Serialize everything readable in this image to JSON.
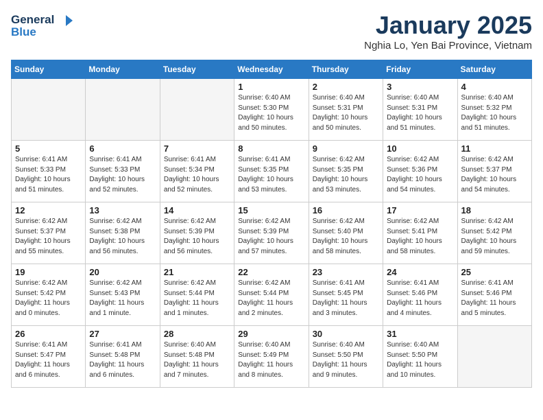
{
  "header": {
    "logo_line1": "General",
    "logo_line2": "Blue",
    "month": "January 2025",
    "location": "Nghia Lo, Yen Bai Province, Vietnam"
  },
  "days_of_week": [
    "Sunday",
    "Monday",
    "Tuesday",
    "Wednesday",
    "Thursday",
    "Friday",
    "Saturday"
  ],
  "weeks": [
    [
      {
        "day": "",
        "info": ""
      },
      {
        "day": "",
        "info": ""
      },
      {
        "day": "",
        "info": ""
      },
      {
        "day": "1",
        "info": "Sunrise: 6:40 AM\nSunset: 5:30 PM\nDaylight: 10 hours\nand 50 minutes."
      },
      {
        "day": "2",
        "info": "Sunrise: 6:40 AM\nSunset: 5:31 PM\nDaylight: 10 hours\nand 50 minutes."
      },
      {
        "day": "3",
        "info": "Sunrise: 6:40 AM\nSunset: 5:31 PM\nDaylight: 10 hours\nand 51 minutes."
      },
      {
        "day": "4",
        "info": "Sunrise: 6:40 AM\nSunset: 5:32 PM\nDaylight: 10 hours\nand 51 minutes."
      }
    ],
    [
      {
        "day": "5",
        "info": "Sunrise: 6:41 AM\nSunset: 5:33 PM\nDaylight: 10 hours\nand 51 minutes."
      },
      {
        "day": "6",
        "info": "Sunrise: 6:41 AM\nSunset: 5:33 PM\nDaylight: 10 hours\nand 52 minutes."
      },
      {
        "day": "7",
        "info": "Sunrise: 6:41 AM\nSunset: 5:34 PM\nDaylight: 10 hours\nand 52 minutes."
      },
      {
        "day": "8",
        "info": "Sunrise: 6:41 AM\nSunset: 5:35 PM\nDaylight: 10 hours\nand 53 minutes."
      },
      {
        "day": "9",
        "info": "Sunrise: 6:42 AM\nSunset: 5:35 PM\nDaylight: 10 hours\nand 53 minutes."
      },
      {
        "day": "10",
        "info": "Sunrise: 6:42 AM\nSunset: 5:36 PM\nDaylight: 10 hours\nand 54 minutes."
      },
      {
        "day": "11",
        "info": "Sunrise: 6:42 AM\nSunset: 5:37 PM\nDaylight: 10 hours\nand 54 minutes."
      }
    ],
    [
      {
        "day": "12",
        "info": "Sunrise: 6:42 AM\nSunset: 5:37 PM\nDaylight: 10 hours\nand 55 minutes."
      },
      {
        "day": "13",
        "info": "Sunrise: 6:42 AM\nSunset: 5:38 PM\nDaylight: 10 hours\nand 56 minutes."
      },
      {
        "day": "14",
        "info": "Sunrise: 6:42 AM\nSunset: 5:39 PM\nDaylight: 10 hours\nand 56 minutes."
      },
      {
        "day": "15",
        "info": "Sunrise: 6:42 AM\nSunset: 5:39 PM\nDaylight: 10 hours\nand 57 minutes."
      },
      {
        "day": "16",
        "info": "Sunrise: 6:42 AM\nSunset: 5:40 PM\nDaylight: 10 hours\nand 58 minutes."
      },
      {
        "day": "17",
        "info": "Sunrise: 6:42 AM\nSunset: 5:41 PM\nDaylight: 10 hours\nand 58 minutes."
      },
      {
        "day": "18",
        "info": "Sunrise: 6:42 AM\nSunset: 5:42 PM\nDaylight: 10 hours\nand 59 minutes."
      }
    ],
    [
      {
        "day": "19",
        "info": "Sunrise: 6:42 AM\nSunset: 5:42 PM\nDaylight: 11 hours\nand 0 minutes."
      },
      {
        "day": "20",
        "info": "Sunrise: 6:42 AM\nSunset: 5:43 PM\nDaylight: 11 hours\nand 1 minute."
      },
      {
        "day": "21",
        "info": "Sunrise: 6:42 AM\nSunset: 5:44 PM\nDaylight: 11 hours\nand 1 minutes."
      },
      {
        "day": "22",
        "info": "Sunrise: 6:42 AM\nSunset: 5:44 PM\nDaylight: 11 hours\nand 2 minutes."
      },
      {
        "day": "23",
        "info": "Sunrise: 6:41 AM\nSunset: 5:45 PM\nDaylight: 11 hours\nand 3 minutes."
      },
      {
        "day": "24",
        "info": "Sunrise: 6:41 AM\nSunset: 5:46 PM\nDaylight: 11 hours\nand 4 minutes."
      },
      {
        "day": "25",
        "info": "Sunrise: 6:41 AM\nSunset: 5:46 PM\nDaylight: 11 hours\nand 5 minutes."
      }
    ],
    [
      {
        "day": "26",
        "info": "Sunrise: 6:41 AM\nSunset: 5:47 PM\nDaylight: 11 hours\nand 6 minutes."
      },
      {
        "day": "27",
        "info": "Sunrise: 6:41 AM\nSunset: 5:48 PM\nDaylight: 11 hours\nand 6 minutes."
      },
      {
        "day": "28",
        "info": "Sunrise: 6:40 AM\nSunset: 5:48 PM\nDaylight: 11 hours\nand 7 minutes."
      },
      {
        "day": "29",
        "info": "Sunrise: 6:40 AM\nSunset: 5:49 PM\nDaylight: 11 hours\nand 8 minutes."
      },
      {
        "day": "30",
        "info": "Sunrise: 6:40 AM\nSunset: 5:50 PM\nDaylight: 11 hours\nand 9 minutes."
      },
      {
        "day": "31",
        "info": "Sunrise: 6:40 AM\nSunset: 5:50 PM\nDaylight: 11 hours\nand 10 minutes."
      },
      {
        "day": "",
        "info": ""
      }
    ]
  ]
}
